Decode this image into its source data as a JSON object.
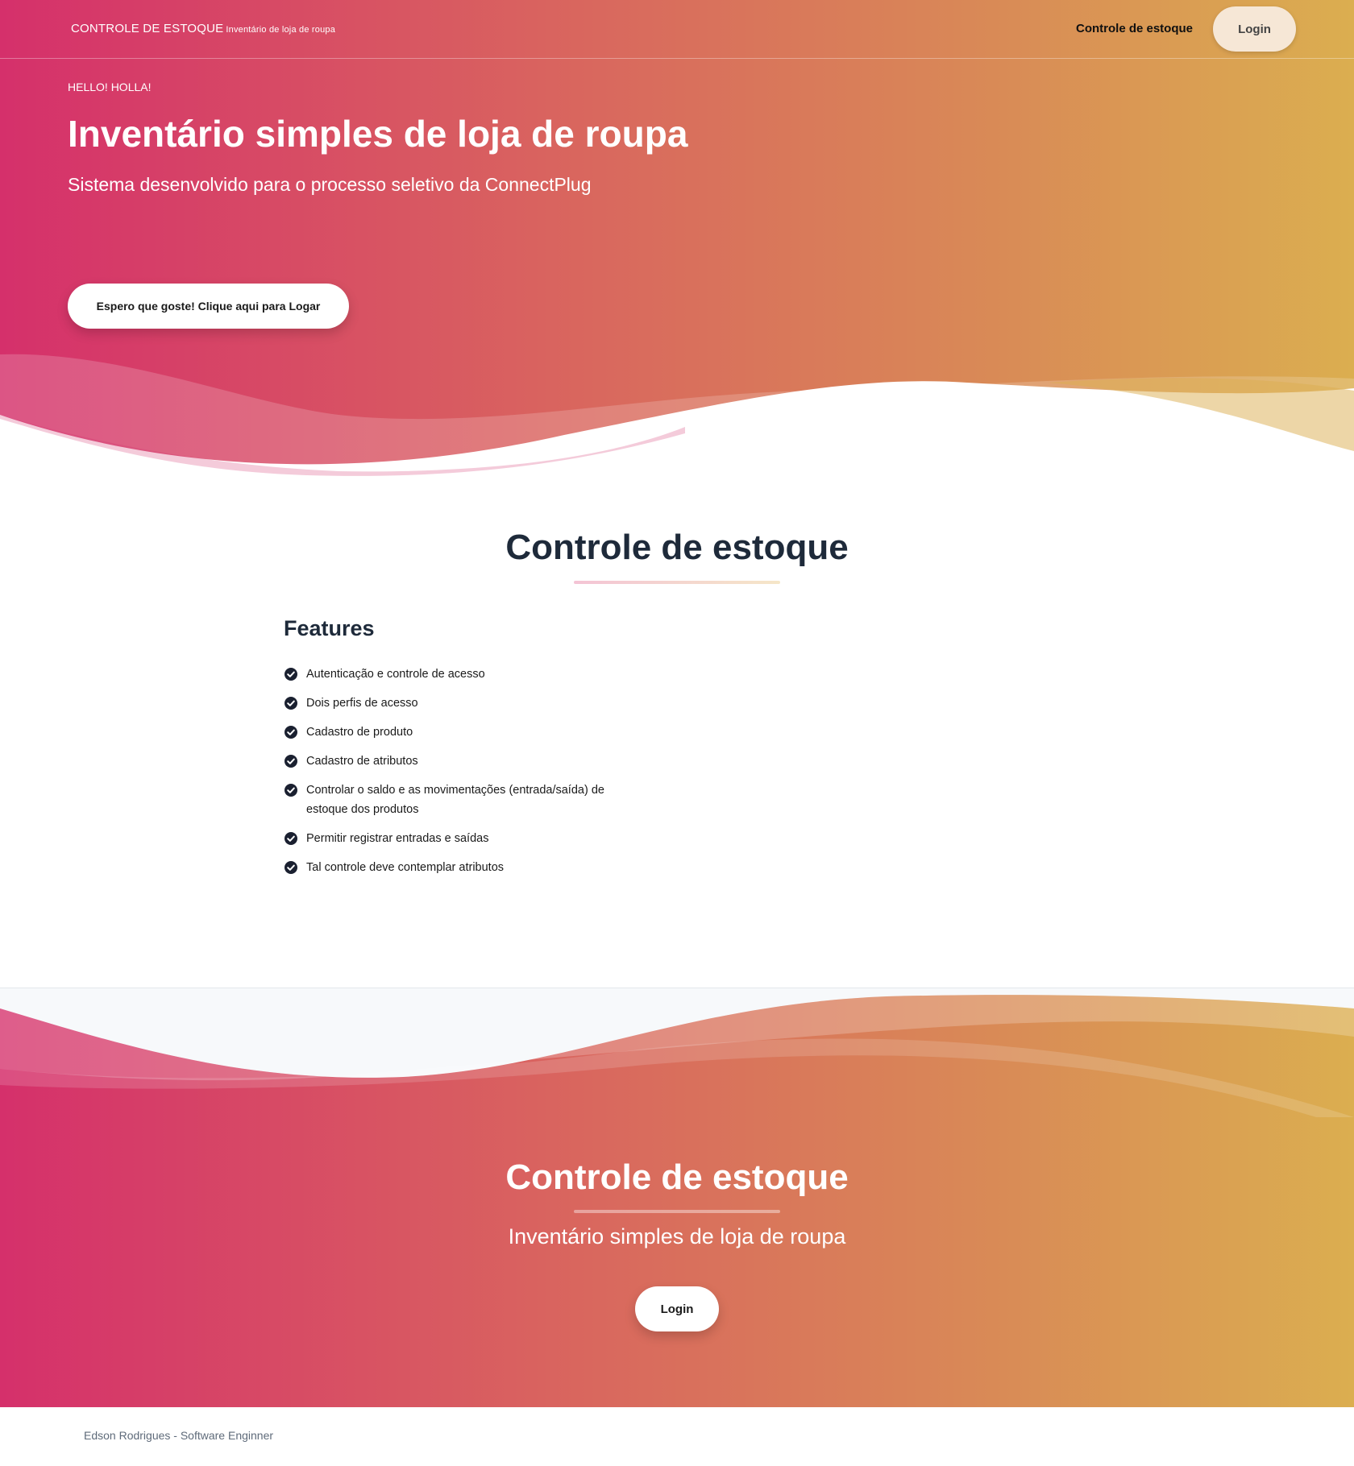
{
  "header": {
    "brand": "CONTROLE DE ESTOQUE",
    "brand_sub": "Inventário de loja de roupa",
    "nav_link": "Controle de estoque",
    "login_label": "Login"
  },
  "hero": {
    "eyebrow": "HELLO! HOLLA!",
    "title": "Inventário simples de loja de roupa",
    "subtitle": "Sistema desenvolvido para o processo seletivo da ConnectPlug",
    "cta_label": "Espero que goste! Clique aqui para Logar"
  },
  "main": {
    "title": "Controle de estoque",
    "features_title": "Features",
    "features": [
      "Autenticação e controle de acesso",
      "Dois perfis de acesso",
      "Cadastro de produto",
      "Cadastro de atributos",
      "Controlar o saldo e as movimentações (entrada/saída) de estoque dos produtos",
      "Permitir registrar entradas e saídas",
      "Tal controle deve contemplar atributos"
    ]
  },
  "footer_cta": {
    "title": "Controle de estoque",
    "subtitle": "Inventário simples de loja de roupa",
    "login_label": "Login"
  },
  "footer": {
    "credit": "Edson Rodrigues - Software Enginner"
  },
  "colors": {
    "gradient_start": "#d5306b",
    "gradient_end": "#dbae50",
    "dark_text": "#1e2a3a"
  }
}
